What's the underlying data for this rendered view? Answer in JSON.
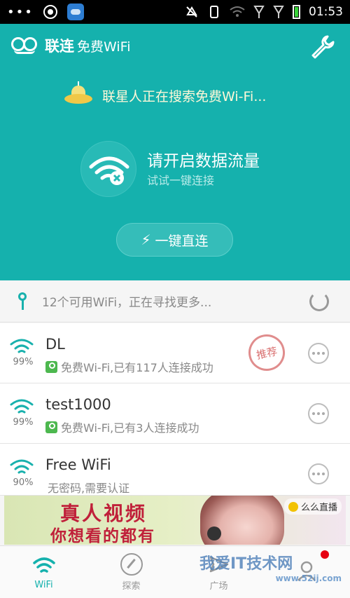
{
  "status_bar": {
    "time": "01:53"
  },
  "header": {
    "app_name": "联连",
    "app_sub": "免费WiFi",
    "search_status": "联星人正在搜索免费Wi-Fi...",
    "connect_title": "请开启数据流量",
    "connect_subtitle": "试试一键连接",
    "one_key_button": "一键直连"
  },
  "available": {
    "text": "12个可用WiFi，正在寻找更多..."
  },
  "networks": [
    {
      "name": "DL",
      "signal": "99%",
      "desc": "免费Wi-Fi,已有117人连接成功",
      "badge": "推荐"
    },
    {
      "name": "test1000",
      "signal": "99%",
      "desc": "免费Wi-Fi,已有3人连接成功"
    },
    {
      "name": "Free WiFi",
      "signal": "90%",
      "desc": "无密码,需要认证"
    }
  ],
  "banner": {
    "line1": "真人视频",
    "line2": "你想看的都有",
    "live_label": "么么直播"
  },
  "bottom_nav": {
    "tabs": [
      {
        "label": "WiFi"
      },
      {
        "label": "探索"
      },
      {
        "label": "广场"
      },
      {
        "label": ""
      }
    ]
  },
  "watermark": {
    "text": "我爱IT技术网",
    "url": "www.52ij.com"
  },
  "colors": {
    "accent": "#15b1ad",
    "alert": "#e60012"
  }
}
